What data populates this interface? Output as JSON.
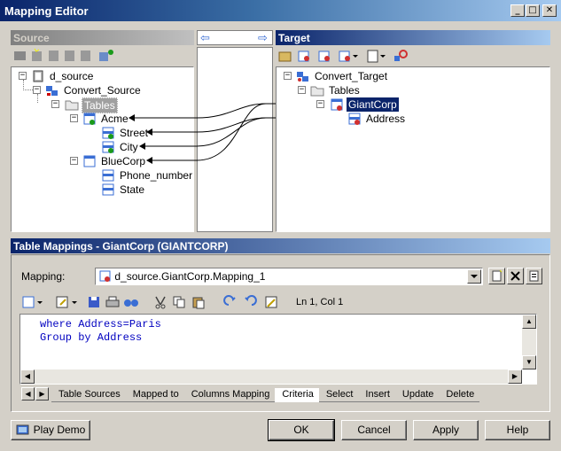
{
  "window": {
    "title": "Mapping Editor",
    "minimize": "_",
    "maximize": "□",
    "close": "✕"
  },
  "source": {
    "header": "Source",
    "tree": {
      "root": "d_source",
      "model": "Convert_Source",
      "tables_folder": "Tables",
      "tables": [
        {
          "label": "Acme",
          "columns": [
            "Street",
            "City"
          ]
        },
        {
          "label": "BlueCorp",
          "columns": [
            "Phone_number",
            "State"
          ]
        }
      ]
    }
  },
  "target": {
    "header": "Target",
    "tree": {
      "model": "Convert_Target",
      "tables_folder": "Tables",
      "table": "GiantCorp",
      "column": "Address"
    }
  },
  "nav": {
    "left_arrow": "⇦",
    "right_arrow": "⇨"
  },
  "table_mappings": {
    "header": "Table Mappings - GiantCorp (GIANTCORP)",
    "mapping_label": "Mapping:",
    "mapping_value": "d_source.GiantCorp.Mapping_1",
    "position": "Ln 1, Col 1",
    "code_lines": [
      "where Address=Paris",
      "Group by Address"
    ],
    "tabs": [
      "Table Sources",
      "Mapped to",
      "Columns Mapping",
      "Criteria",
      "Select",
      "Insert",
      "Update",
      "Delete"
    ],
    "active_tab": "Criteria"
  },
  "footer": {
    "play_demo": "Play Demo",
    "ok": "OK",
    "cancel": "Cancel",
    "apply": "Apply",
    "help": "Help"
  },
  "colors": {
    "title_gradient_start": "#0a246a",
    "title_gradient_end": "#a6caf0",
    "dialog_face": "#d4d0c8",
    "selection_blue": "#0a246a",
    "code_keyword": "#0000c0"
  }
}
